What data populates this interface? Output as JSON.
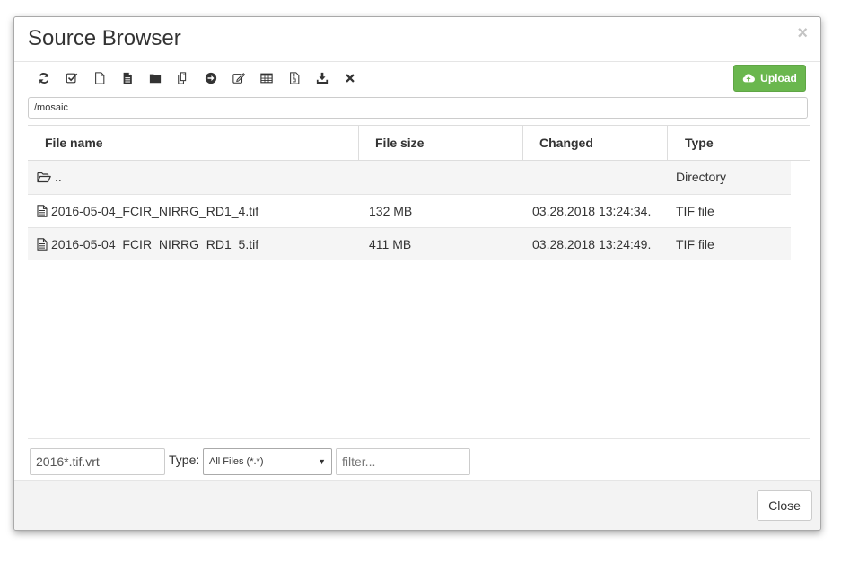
{
  "dialog": {
    "title": "Source Browser",
    "close_symbol": "×"
  },
  "toolbar": {
    "icons": [
      "refresh-icon",
      "check-square-icon",
      "new-file-icon",
      "file-text-icon",
      "folder-icon",
      "copy-icon",
      "arrow-circle-right-icon",
      "edit-icon",
      "table-icon",
      "zip-file-icon",
      "download-icon",
      "close-icon"
    ],
    "upload_label": "Upload",
    "upload_color": "#6ab74e"
  },
  "path": {
    "value": "/mosaic"
  },
  "table": {
    "headers": {
      "name": "File name",
      "size": "File size",
      "changed": "Changed",
      "type": "Type"
    },
    "rows": [
      {
        "name": "..",
        "size": "",
        "changed": "",
        "type": "Directory",
        "icon": "folder-open-icon"
      },
      {
        "name": "2016-05-04_FCIR_NIRRG_RD1_4.tif",
        "size": "132 MB",
        "changed": "03.28.2018 13:24:34.",
        "type": "TIF file",
        "icon": "file-icon"
      },
      {
        "name": "2016-05-04_FCIR_NIRRG_RD1_5.tif",
        "size": "411 MB",
        "changed": "03.28.2018 13:24:49.",
        "type": "TIF file",
        "icon": "file-icon"
      }
    ]
  },
  "footer_controls": {
    "filename_value": "2016*.tif.vrt",
    "type_label": "Type:",
    "type_selected": "All Files (*.*)",
    "filter_placeholder": "filter..."
  },
  "footer": {
    "close_label": "Close"
  }
}
